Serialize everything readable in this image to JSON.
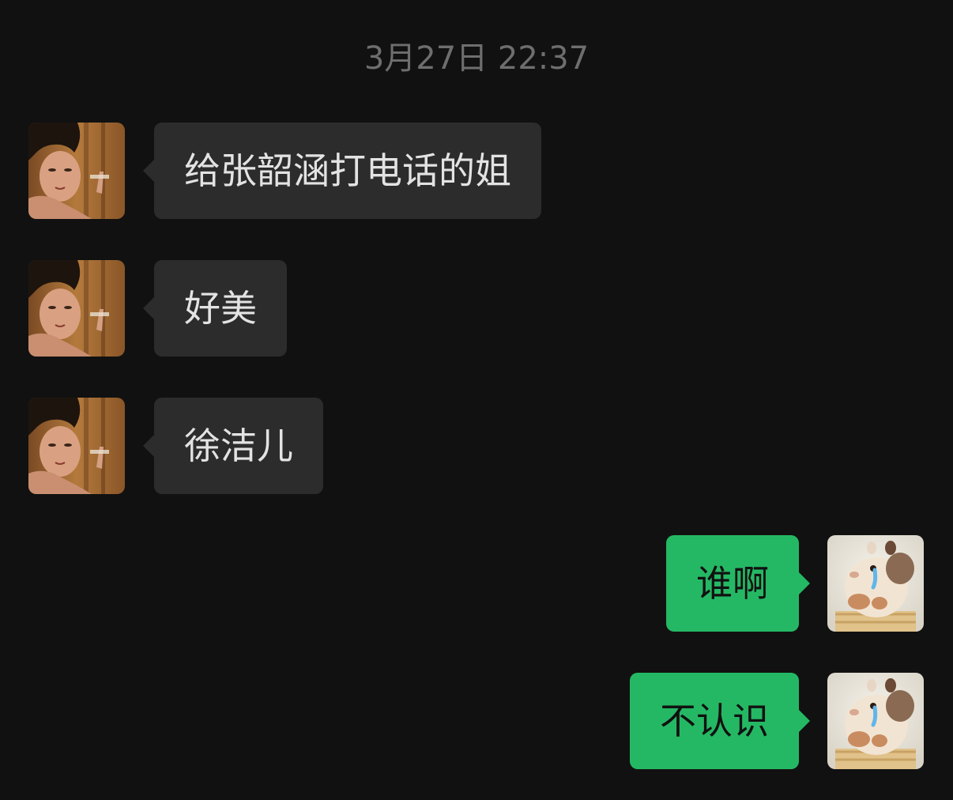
{
  "chat": {
    "timestamp": "3月27日 22:37",
    "messages": [
      {
        "sender": "contact",
        "text": "给张韶涵打电话的姐",
        "avatar": "woman-photo-avatar"
      },
      {
        "sender": "contact",
        "text": "好美",
        "avatar": "woman-photo-avatar"
      },
      {
        "sender": "contact",
        "text": "徐洁儿",
        "avatar": "woman-photo-avatar"
      },
      {
        "sender": "self",
        "text": "谁啊",
        "avatar": "hamster-avatar"
      },
      {
        "sender": "self",
        "text": "不认识",
        "avatar": "hamster-avatar"
      }
    ]
  },
  "colors": {
    "background": "#111111",
    "incoming_bubble": "#2c2c2c",
    "outgoing_bubble": "#25b864",
    "timestamp_text": "#6e6e6e"
  }
}
